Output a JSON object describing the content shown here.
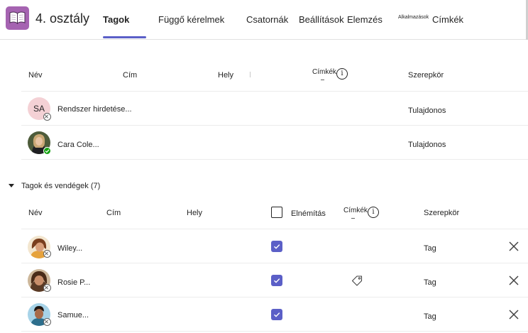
{
  "team": {
    "name": "4. osztály",
    "icon": "book-icon",
    "icon_color": "#a563b1"
  },
  "tabs": [
    {
      "label": "Tagok",
      "active": true
    },
    {
      "label": "Függő kérelmek",
      "active": false
    },
    {
      "label": "Csatornák",
      "active": false
    },
    {
      "label": "Beállítások",
      "active": false
    },
    {
      "label": "Elemzés",
      "active": false
    },
    {
      "label": "Alkalmazások",
      "active": false
    },
    {
      "label": "Címkék",
      "active": false
    }
  ],
  "accent_color": "#5b5fc7",
  "owners": {
    "columns": {
      "name": "Név",
      "title": "Cím",
      "location": "Hely",
      "tags": "Címkék",
      "role": "Szerepkör"
    },
    "rows": [
      {
        "initials": "SA",
        "name": "Rendszer hirdetése...",
        "role": "Tulajdonos",
        "status": "offline"
      },
      {
        "initials": "",
        "name": "Cara Cole...",
        "role": "Tulajdonos",
        "status": "online"
      }
    ]
  },
  "members": {
    "section_title": "Tagok és vendégek (7)",
    "expanded": true,
    "columns": {
      "name": "Név",
      "title": "Cím",
      "location": "Hely",
      "mute": "Elnémítás",
      "tags": "Címkék",
      "role": "Szerepkör"
    },
    "rows": [
      {
        "name": "Wiley...",
        "role": "Tag",
        "muted": true,
        "has_tag_icon": false,
        "status": "offline"
      },
      {
        "name": "Rosie P...",
        "role": "Tag",
        "muted": true,
        "has_tag_icon": true,
        "status": "offline"
      },
      {
        "name": "Samue...",
        "role": "Tag",
        "muted": true,
        "has_tag_icon": false,
        "status": "offline"
      }
    ]
  }
}
